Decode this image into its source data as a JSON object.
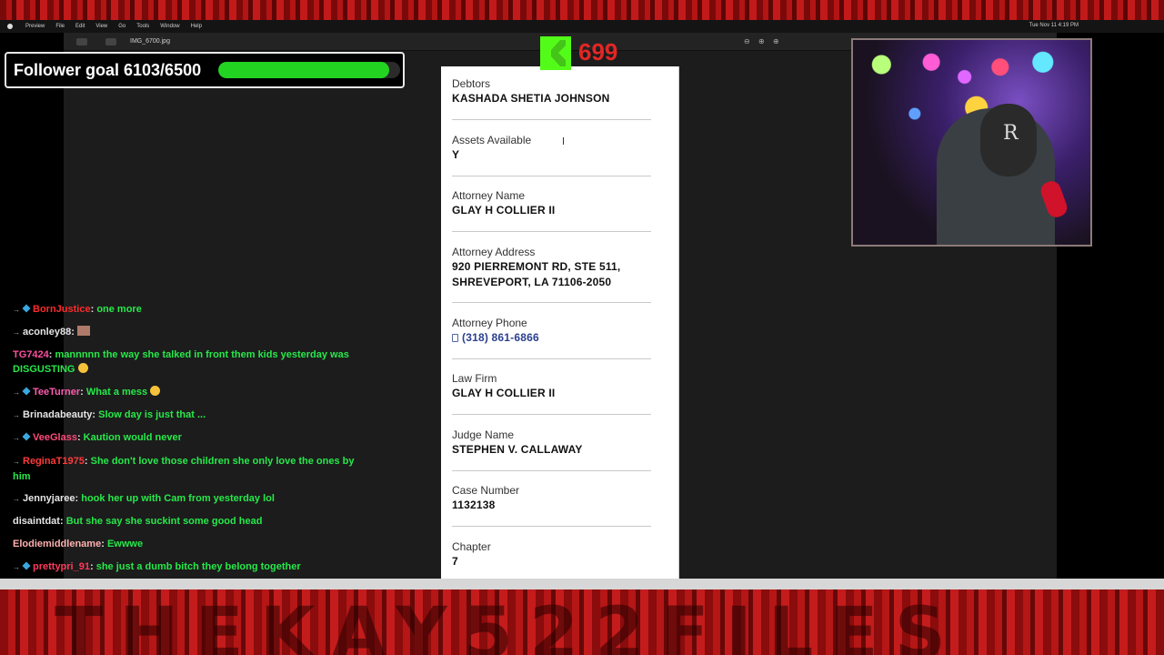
{
  "menubar": {
    "items": [
      "Preview",
      "File",
      "Edit",
      "View",
      "Go",
      "Tools",
      "Window",
      "Help"
    ],
    "clock": "Tue Nov 11  4:19 PM"
  },
  "window": {
    "filename": "IMG_6700.jpg",
    "zoom_out": "⊖",
    "zoom_in": "⊕",
    "zoom_fit": "⊕"
  },
  "document": {
    "fields": [
      {
        "label": "Debtors",
        "value": "KASHADA SHETIA JOHNSON"
      },
      {
        "label": "Assets Available",
        "value": "Y"
      },
      {
        "label": "Attorney Name",
        "value": "GLAY H COLLIER II"
      },
      {
        "label": "Attorney Address",
        "value": "920 PIERREMONT RD, STE 511,",
        "value2": "SHREVEPORT, LA 71106-2050"
      },
      {
        "label": "Attorney Phone",
        "value": "(318) 861-6866"
      },
      {
        "label": "Law Firm",
        "value": "GLAY H COLLIER II"
      },
      {
        "label": "Judge Name",
        "value": "STEPHEN V. CALLAWAY"
      },
      {
        "label": "Case Number",
        "value": "1132138"
      },
      {
        "label": "Chapter",
        "value": "7"
      }
    ]
  },
  "goal": {
    "text": "Follower goal 6103/6500",
    "progress": 0.939
  },
  "kick": {
    "viewers": "699"
  },
  "webcam": {
    "hat_letter": "R"
  },
  "chat": {
    "messages": [
      {
        "user": "BornJustice",
        "color": "#ff2a2a",
        "badges": true,
        "cube": true,
        "text": "one more"
      },
      {
        "user": "aconley88",
        "color": "#e6e6e6",
        "badges": true,
        "cube": false,
        "text": "",
        "emote": true
      },
      {
        "user": "TG7424",
        "color": "#ff4fa0",
        "badges": false,
        "cube": false,
        "text": "mannnnn the way she talked in front them kids yesterday was DISGUSTING",
        "emoji": true
      },
      {
        "user": "TeeTurner",
        "color": "#ff5cb0",
        "badges": true,
        "cube": true,
        "text": "What a mess",
        "emoji": true
      },
      {
        "user": "Brinadabeauty",
        "color": "#e6e6e6",
        "badges": true,
        "cube": false,
        "text": "Slow day is just that ..."
      },
      {
        "user": "VeeGlass",
        "color": "#ff4a7a",
        "badges": true,
        "cube": true,
        "text": "Kaution would never"
      },
      {
        "user": "ReginaT1975",
        "color": "#ff3a3a",
        "badges": true,
        "cube": false,
        "text": "She don't love those children she only love the ones by him"
      },
      {
        "user": "Jennyjaree",
        "color": "#e6e6e6",
        "badges": true,
        "cube": false,
        "text": "hook her up with Cam from yesterday lol"
      },
      {
        "user": "disaintdat",
        "color": "#e6e6e6",
        "badges": false,
        "cube": false,
        "text": "But she say she suckint some good head"
      },
      {
        "user": "Elodiemiddlename",
        "color": "#ffb0b0",
        "badges": false,
        "cube": false,
        "text": "Ewwwe"
      },
      {
        "user": "prettypri_91",
        "color": "#ff3a5a",
        "badges": true,
        "cube": true,
        "text": "she just a dumb bitch they belong together"
      }
    ]
  },
  "frame": {
    "brand": "THEKAY522FILES"
  }
}
